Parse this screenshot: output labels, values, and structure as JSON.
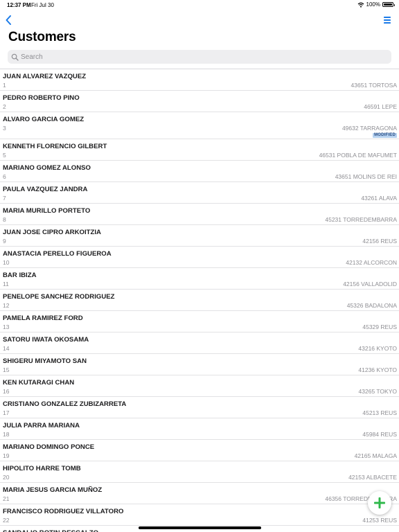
{
  "status_bar": {
    "time": "12:37 PM",
    "date": "Fri Jul 30",
    "battery": "100%",
    "battery_level": 1.0
  },
  "page": {
    "title": "Customers"
  },
  "search": {
    "placeholder": "Search"
  },
  "colors": {
    "accent": "#1a7ae8",
    "fab_plus": "#2fb84b",
    "badge_bg": "#b5d1ef",
    "secondary_text": "#8e8e93"
  },
  "icons": {
    "back": "chevron-left-icon",
    "menu": "menu-icon",
    "search": "search-icon",
    "add": "plus-icon",
    "wifi": "wifi-icon",
    "battery": "battery-icon"
  },
  "customers": [
    {
      "name": "JUAN ALVAREZ VAZQUEZ",
      "number": "1",
      "location": "43651 TORTOSA"
    },
    {
      "name": "PEDRO ROBERTO PINO",
      "number": "2",
      "location": "46591 LEPE"
    },
    {
      "name": "ALVARO GARCIA GOMEZ",
      "number": "3",
      "location": "49632 TARRAGONA",
      "badge": "MODIFIED"
    },
    {
      "name": "KENNETH FLORENCIO GILBERT",
      "number": "5",
      "location": "46531 POBLA DE MAFUMET"
    },
    {
      "name": "MARIANO GOMEZ ALONSO",
      "number": "6",
      "location": "43651 MOLINS DE REI"
    },
    {
      "name": "PAULA VAZQUEZ JANDRA",
      "number": "7",
      "location": "43261 ALAVA"
    },
    {
      "name": "MARIA MURILLO PORTETO",
      "number": "8",
      "location": "45231 TORREDEMBARRA"
    },
    {
      "name": "JUAN JOSE CIPRO ARKOITZIA",
      "number": "9",
      "location": "42156 REUS"
    },
    {
      "name": "ANASTACIA PERELLO FIGUEROA",
      "number": "10",
      "location": "42132 ALCORCON"
    },
    {
      "name": "BAR IBIZA",
      "number": "11",
      "location": "42156 VALLADOLID"
    },
    {
      "name": "PENELOPE SANCHEZ RODRIGUEZ",
      "number": "12",
      "location": "45326 BADALONA"
    },
    {
      "name": "PAMELA RAMIREZ FORD",
      "number": "13",
      "location": "45329 REUS"
    },
    {
      "name": "SATORU IWATA OKOSAMA",
      "number": "14",
      "location": "43216 KYOTO"
    },
    {
      "name": "SHIGERU MIYAMOTO SAN",
      "number": "15",
      "location": "41236 KYOTO"
    },
    {
      "name": "KEN KUTARAGI CHAN",
      "number": "16",
      "location": "43265 TOKYO"
    },
    {
      "name": "CRISTIANO GONZALEZ  ZUBIZARRETA",
      "number": "17",
      "location": "45213 REUS"
    },
    {
      "name": "JULIA PARRA MARIANA",
      "number": "18",
      "location": "45984 REUS"
    },
    {
      "name": "MARIANO DOMINGO PONCE",
      "number": "19",
      "location": "42165 MALAGA"
    },
    {
      "name": "HIPOLITO HARRE TOMB",
      "number": "20",
      "location": "42153 ALBACETE"
    },
    {
      "name": "MARIA JESUS GARCIA MUÑOZ",
      "number": "21",
      "location": "46356 TORREDEMBARRA"
    },
    {
      "name": "FRANCISCO RODRIGUEZ VILLATORO",
      "number": "22",
      "location": "41253 REUS"
    },
    {
      "name": "SANDALIO BOTIN DESCALZO",
      "number": "23",
      "location": ""
    }
  ]
}
